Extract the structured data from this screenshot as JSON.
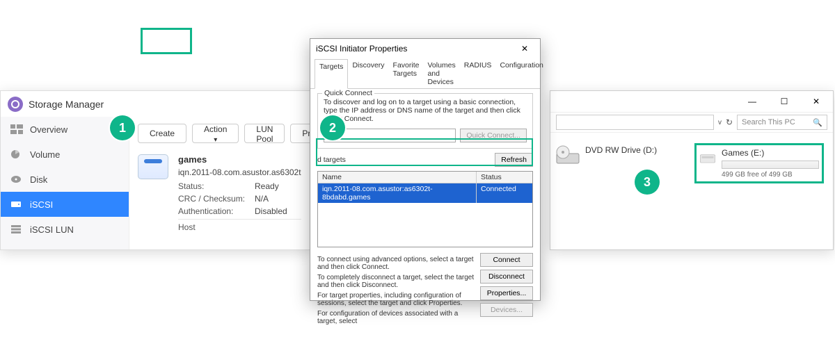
{
  "steps": {
    "one": "1",
    "two": "2",
    "three": "3"
  },
  "storage_manager": {
    "title": "Storage Manager",
    "nav": {
      "overview": "Overview",
      "volume": "Volume",
      "disk": "Disk",
      "iscsi": "iSCSI",
      "iscsi_lun": "iSCSI LUN"
    },
    "toolbar": {
      "create": "Create",
      "action": "Action",
      "lun_pool": "LUN Pool",
      "pr": "Pr"
    },
    "target": {
      "name": "games",
      "iqn": "iqn.2011-08.com.asustor.as6302t",
      "status_label": "Status:",
      "status_value": "Ready",
      "crc_label": "CRC / Checksum:",
      "crc_value": "N/A",
      "auth_label": "Authentication:",
      "auth_value": "Disabled",
      "host_label": "Host"
    }
  },
  "iscsi": {
    "title": "iSCSI Initiator Properties",
    "tabs": {
      "targets": "Targets",
      "discovery": "Discovery",
      "favorite": "Favorite Targets",
      "volumes": "Volumes and Devices",
      "radius": "RADIUS",
      "config": "Configuration"
    },
    "quick_connect": {
      "group": "Quick Connect",
      "desc": "To discover and log on to a target using a basic connection, type the IP address or DNS name of the target and then click Quick Connect.",
      "button": "Quick Connect..."
    },
    "discovered": {
      "group": "d targets",
      "refresh": "Refresh",
      "col_name": "Name",
      "col_status": "Status",
      "row_name": "iqn.2011-08.com.asustor:as6302t-8bdabd.games",
      "row_status": "Connected"
    },
    "help": {
      "connect": "To connect using advanced options, select a target and then click Connect.",
      "disconnect": "To completely disconnect a target, select the target and then click Disconnect.",
      "properties": "For target properties, including configuration of sessions, select the target and click Properties.",
      "devices": "For configuration of devices associated with a target, select"
    },
    "buttons": {
      "connect": "Connect",
      "disconnect": "Disconnect",
      "properties": "Properties...",
      "devices": "Devices..."
    }
  },
  "explorer": {
    "search_placeholder": "Search This PC",
    "drive1": {
      "name": "DVD RW Drive (D:)"
    },
    "drive2": {
      "name": "Games (E:)",
      "sub": "499 GB free of 499 GB"
    }
  }
}
